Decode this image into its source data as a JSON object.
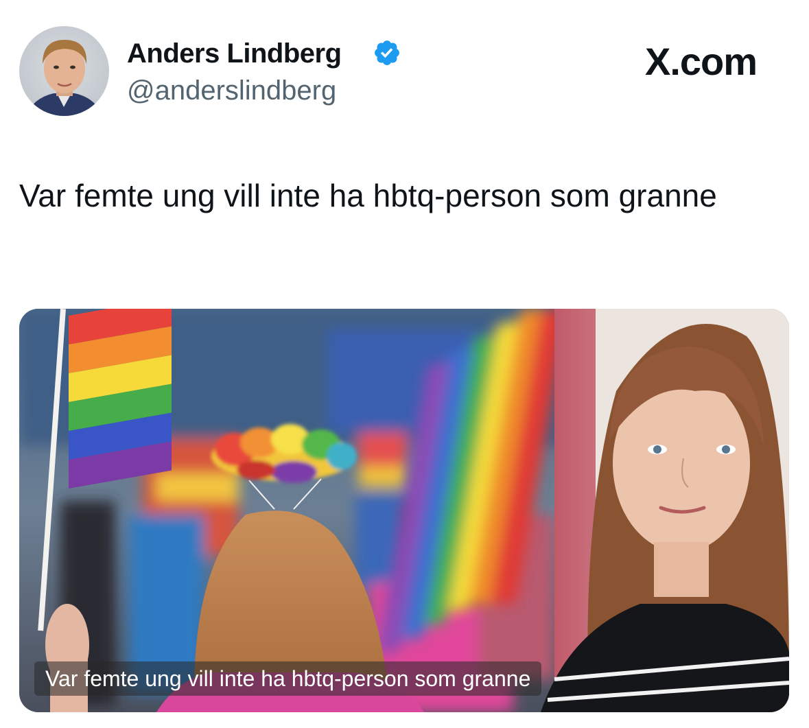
{
  "author": {
    "name": "Anders Lindberg",
    "handle": "@anderslindberg",
    "verified": true
  },
  "site_logo": "X.com",
  "tweet": {
    "text": "Var femte ung vill inte ha hbtq-person som granne"
  },
  "media": {
    "caption": "Var femte ung vill inte ha hbtq-person som granne"
  },
  "colors": {
    "verified_badge": "#1d9bf0",
    "handle_text": "#536471",
    "text": "#0f1419"
  },
  "icons": {
    "verified": "verified-badge-icon",
    "logo": "x-logo"
  }
}
